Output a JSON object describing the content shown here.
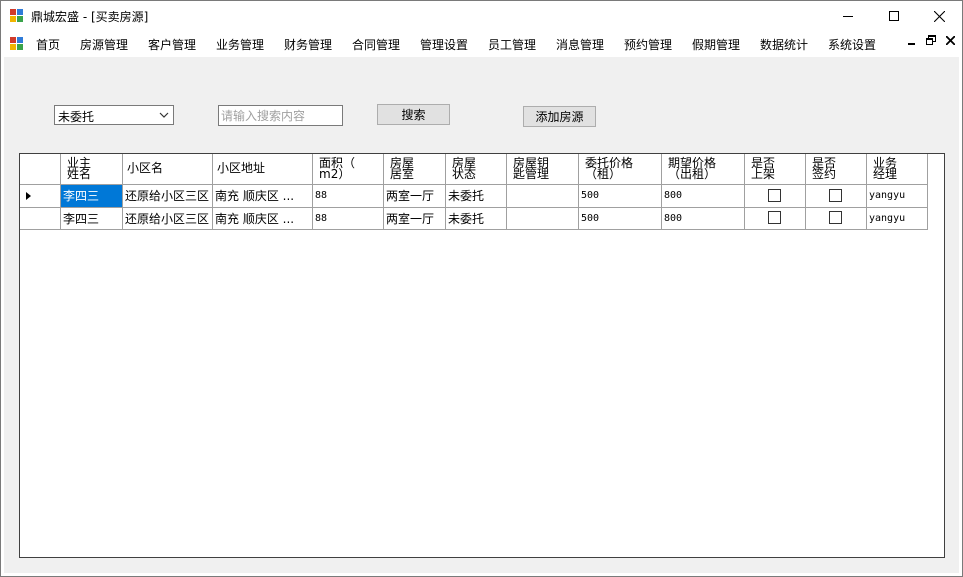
{
  "window": {
    "title": "鼎城宏盛 - [买卖房源]"
  },
  "menu": {
    "items": [
      "首页",
      "房源管理",
      "客户管理",
      "业务管理",
      "财务管理",
      "合同管理",
      "管理设置",
      "员工管理",
      "消息管理",
      "预约管理",
      "假期管理",
      "数据统计",
      "系统设置"
    ]
  },
  "filter": {
    "status_value": "未委托",
    "search_placeholder": "请输入搜索内容",
    "search_label": "搜索",
    "add_label": "添加房源"
  },
  "grid": {
    "columns": [
      "业主\n姓名",
      "小区名",
      "小区地址",
      "面积（\nm2）",
      "房屋\n居室",
      "房屋\n状态",
      "房屋钥\n匙管理",
      "委托价格\n（租）",
      "期望价格\n（出租）",
      "是否\n上架",
      "是否\n签约",
      "业务\n经理"
    ],
    "rows": [
      {
        "owner": "李四三",
        "community": "还原给小区三区",
        "address": "南充 顺庆区 ...",
        "area": "88",
        "rooms": "两室一厅",
        "status": "未委托",
        "key_mgmt": "",
        "entrust_price": "500",
        "expected_price": "800",
        "listed": false,
        "signed": false,
        "manager": "yangyu"
      },
      {
        "owner": "李四三",
        "community": "还原给小区三区",
        "address": "南充 顺庆区 ...",
        "area": "88",
        "rooms": "两室一厅",
        "status": "未委托",
        "key_mgmt": "",
        "entrust_price": "500",
        "expected_price": "800",
        "listed": false,
        "signed": false,
        "manager": "yangyu"
      }
    ]
  },
  "colors": {
    "selection": "#0078d7",
    "client_bg": "#f0f0f0",
    "button_bg": "#e1e1e1"
  }
}
